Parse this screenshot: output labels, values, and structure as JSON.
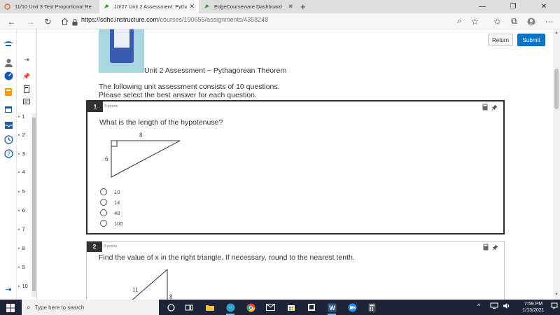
{
  "browser": {
    "tabs": [
      {
        "title": "11/10 Unit 3 Test Proportional Re",
        "active": false
      },
      {
        "title": "10/27 Unit 2 Assessment: Pythag",
        "active": true
      },
      {
        "title": "EdgeCourseware Dashboard",
        "active": false
      }
    ],
    "url_host": "https://sdhc.instructure.com",
    "url_path": "/courses/190655/assignments/4358248"
  },
  "header": {
    "return_label": "Return",
    "submit_label": "Submit"
  },
  "assessment": {
    "title": "Unit 2 Assessment ~ Pythagorean Theorem",
    "intro_line1": "The following unit assessment consists of 10 questions.",
    "intro_line2": "Please select the best answer for each question."
  },
  "question_nav": [
    "1",
    "2",
    "3",
    "4",
    "5",
    "6",
    "7",
    "8",
    "9",
    "10"
  ],
  "questions": [
    {
      "number": "1",
      "points": "3 points",
      "text": "What is the length of the hypotenuse?",
      "figure_labels": {
        "top": "8",
        "left": "6"
      },
      "answers": [
        "10",
        "14",
        "48",
        "100"
      ]
    },
    {
      "number": "2",
      "points": "3 points",
      "text": "Find the value of x in the right triangle. If necessary, round to the nearest tenth.",
      "figure_labels": {
        "hyp": "11",
        "side": "8"
      }
    }
  ],
  "taskbar": {
    "search_placeholder": "Type here to search",
    "time": "7:59 PM",
    "date": "1/13/2021"
  },
  "colors": {
    "accent": "#0b74c6",
    "taskbar": "#1c2436",
    "question_tag": "#333333"
  }
}
